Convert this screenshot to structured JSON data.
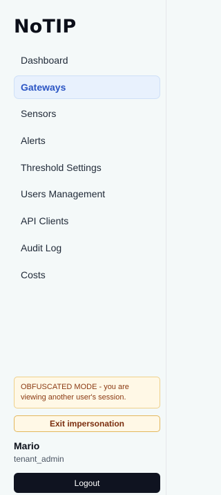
{
  "app": {
    "title": "NoTIP"
  },
  "nav": {
    "items": [
      {
        "label": "Dashboard",
        "active": false
      },
      {
        "label": "Gateways",
        "active": true
      },
      {
        "label": "Sensors",
        "active": false
      },
      {
        "label": "Alerts",
        "active": false
      },
      {
        "label": "Threshold Settings",
        "active": false
      },
      {
        "label": "Users Management",
        "active": false
      },
      {
        "label": "API Clients",
        "active": false
      },
      {
        "label": "Audit Log",
        "active": false
      },
      {
        "label": "Costs",
        "active": false
      }
    ]
  },
  "impersonation": {
    "banner_text": "OBFUSCATED MODE - you are viewing another user's session.",
    "exit_label": "Exit impersonation"
  },
  "user": {
    "name": "Mario",
    "role": "tenant_admin"
  },
  "logout_label": "Logout",
  "colors": {
    "active_text": "#2b55c4",
    "active_bg": "#e8f1fd",
    "warning_bg": "#fff8e6",
    "warning_border": "#e3b75c",
    "logout_bg": "#0f1320"
  }
}
